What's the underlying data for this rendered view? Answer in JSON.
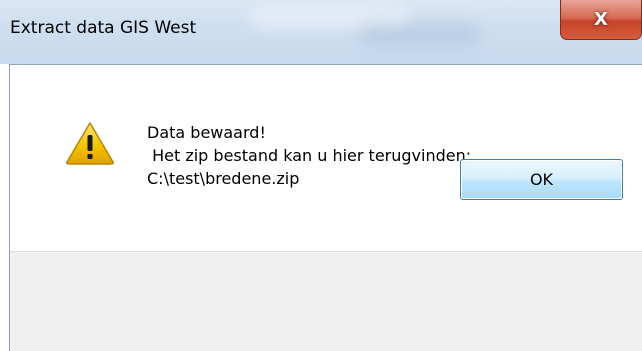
{
  "window": {
    "title": "Extract data GIS West",
    "close_label": "X"
  },
  "dialog": {
    "icon": "warning-icon",
    "message_lines": [
      "Data bewaard!",
      " Het zip bestand kan u hier terugvinden:",
      "C:\\test\\bredene.zip"
    ],
    "ok_label": "OK"
  },
  "colors": {
    "titlebar": "#cfdff0",
    "close_button": "#c4442a",
    "footer": "#f0f0f0",
    "ok_button_border": "#3c7fb1",
    "warning_fill": "#f5c400"
  }
}
